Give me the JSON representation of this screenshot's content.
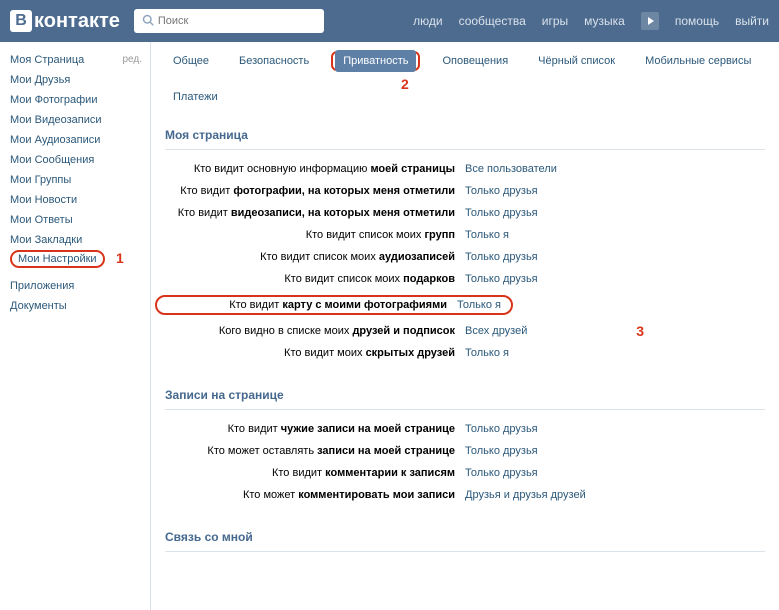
{
  "header": {
    "logo": "контакте",
    "search_placeholder": "Поиск",
    "nav": {
      "people": "люди",
      "communities": "сообщества",
      "games": "игры",
      "music": "музыка",
      "help": "помощь",
      "logout": "выйти"
    }
  },
  "sidebar": {
    "my_page": "Моя Страница",
    "edit": "ред.",
    "friends": "Мои Друзья",
    "photos": "Мои Фотографии",
    "videos": "Мои Видеозаписи",
    "audio": "Мои Аудиозаписи",
    "messages": "Мои Сообщения",
    "groups": "Мои Группы",
    "news": "Мои Новости",
    "answers": "Мои Ответы",
    "bookmarks": "Мои Закладки",
    "settings": "Мои Настройки",
    "apps": "Приложения",
    "docs": "Документы"
  },
  "tabs": {
    "general": "Общее",
    "security": "Безопасность",
    "privacy": "Приватность",
    "notifications": "Оповещения",
    "blacklist": "Чёрный список",
    "mobile": "Мобильные сервисы",
    "payments": "Платежи"
  },
  "annotations": {
    "a1": "1",
    "a2": "2",
    "a3": "3"
  },
  "sections": {
    "my_page": {
      "title": "Моя страница",
      "rows": [
        {
          "label_pre": "Кто видит основную информацию ",
          "label_b": "моей страницы",
          "value": "Все пользователи"
        },
        {
          "label_pre": "Кто видит ",
          "label_b": "фотографии, на которых меня отметили",
          "value": "Только друзья"
        },
        {
          "label_pre": "Кто видит ",
          "label_b": "видеозаписи, на которых меня отметили",
          "value": "Только друзья"
        },
        {
          "label_pre": "Кто видит список моих ",
          "label_b": "групп",
          "value": "Только я"
        },
        {
          "label_pre": "Кто видит список моих ",
          "label_b": "аудиозаписей",
          "value": "Только друзья"
        },
        {
          "label_pre": "Кто видит список моих ",
          "label_b": "подарков",
          "value": "Только друзья"
        },
        {
          "label_pre": "Кто видит ",
          "label_b": "карту с моими фотографиями",
          "value": "Только я",
          "hl": true
        },
        {
          "label_pre": "Кого видно в списке моих ",
          "label_b": "друзей и подписок",
          "value": "Всех друзей"
        },
        {
          "label_pre": "Кто видит моих ",
          "label_b": "скрытых друзей",
          "value": "Только я"
        }
      ]
    },
    "wall": {
      "title": "Записи на странице",
      "rows": [
        {
          "label_pre": "Кто видит ",
          "label_b": "чужие записи на моей странице",
          "value": "Только друзья"
        },
        {
          "label_pre": "Кто может оставлять ",
          "label_b": "записи на моей странице",
          "value": "Только друзья"
        },
        {
          "label_pre": "Кто видит ",
          "label_b": "комментарии к записям",
          "value": "Только друзья"
        },
        {
          "label_pre": "Кто может ",
          "label_b": "комментировать мои записи",
          "value": "Друзья и друзья друзей"
        }
      ]
    },
    "contact": {
      "title": "Связь со мной"
    }
  }
}
